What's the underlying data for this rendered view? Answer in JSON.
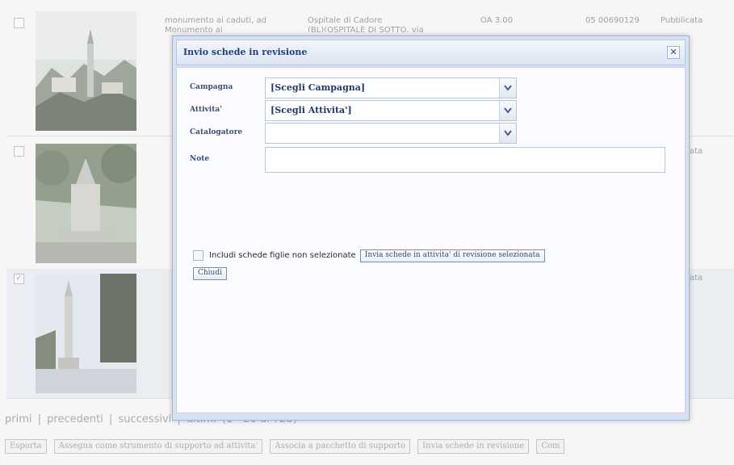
{
  "grid": {
    "rows": [
      {
        "checked": false,
        "thumb_icon": "church-bell-tower-photo",
        "description": "monumento ai caduti, ad",
        "description_2": "Monumento ai",
        "location": "Ospitale di Cadore",
        "location_2": "(BL)(OSPITALE DI SOTTO, via",
        "type": "OA 3.00",
        "code": "05 00690129",
        "status": "Pubblicata"
      },
      {
        "checked": false,
        "thumb_icon": "war-memorial-photo",
        "description": "",
        "location": "",
        "type": "",
        "code": "",
        "status": "Pubblicata"
      },
      {
        "checked": true,
        "thumb_icon": "obelisk-monument-photo",
        "description": "",
        "location": "",
        "type": "",
        "code": "",
        "status": "Pubblicata"
      }
    ]
  },
  "pager": {
    "first": "primi",
    "sep": "|",
    "prev": "precedenti",
    "next": "successivi",
    "last": "ultimi",
    "range": "(1 - 20 di 728)"
  },
  "toolbar": {
    "export": "Esporta",
    "assign": "Assegna come strumento di supporto ad attivita'",
    "associate": "Associa a pacchetto di supporto",
    "send_revision": "Invia schede in revisione",
    "more": "Com"
  },
  "dialog": {
    "title": "Invio schede in revisione",
    "close_icon": "close-icon",
    "fields": {
      "campagna_label": "Campagna",
      "campagna_value": "[Scegli Campagna]",
      "attivita_label": "Attivita'",
      "attivita_value": "[Scegli Attivita']",
      "catalogatore_label": "Catalogatore",
      "catalogatore_value": "",
      "note_label": "Note",
      "note_value": ""
    },
    "include_children_label": "Includi schede figlie non selezionate",
    "include_children_checked": false,
    "send_button": "Invia schede in attivita' di revisione selezionata",
    "close_button": "Chiudi"
  },
  "colors": {
    "dialog_bg": "#d6e2f2",
    "title_text": "#243e78",
    "overlay_text": "#8d8d8d"
  }
}
